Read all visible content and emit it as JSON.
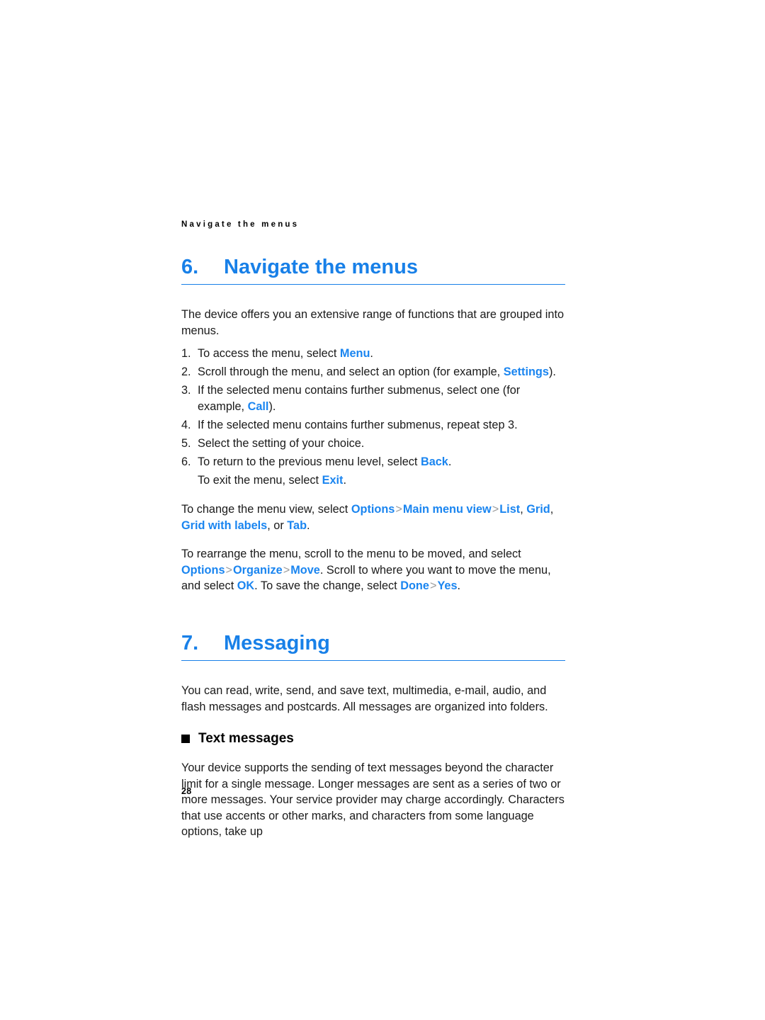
{
  "page": {
    "running_head": "Navigate the menus",
    "folio": "28",
    "accent_color": "#1880E8",
    "inline_accent_color": "#1A85F0",
    "separator_color": "#9b9b9b",
    "background_color": "#ffffff",
    "text_color": "#1a1a1a"
  },
  "chapter_navigate": {
    "number": "6.",
    "title": "Navigate the menus",
    "intro": "The device offers you an extensive range of functions that are grouped into menus.",
    "steps": [
      {
        "marker": "1.",
        "parts": [
          {
            "text": "To access the menu, select ",
            "style": "plain"
          },
          {
            "text": "Menu",
            "style": "ui"
          },
          {
            "text": ".",
            "style": "plain"
          }
        ]
      },
      {
        "marker": "2.",
        "parts": [
          {
            "text": "Scroll through the menu, and select an option (for example, ",
            "style": "plain"
          },
          {
            "text": "Settings",
            "style": "ui"
          },
          {
            "text": ").",
            "style": "plain"
          }
        ]
      },
      {
        "marker": "3.",
        "parts": [
          {
            "text": "If the selected menu contains further submenus, select one (for example, ",
            "style": "plain"
          },
          {
            "text": "Call",
            "style": "ui"
          },
          {
            "text": ").",
            "style": "plain"
          }
        ]
      },
      {
        "marker": "4.",
        "parts": [
          {
            "text": "If the selected menu contains further submenus, repeat step 3.",
            "style": "plain"
          }
        ]
      },
      {
        "marker": "5.",
        "parts": [
          {
            "text": "Select the setting of your choice.",
            "style": "plain"
          }
        ]
      },
      {
        "marker": "6.",
        "parts": [
          {
            "text": "To return to the previous menu level, select ",
            "style": "plain"
          },
          {
            "text": "Back",
            "style": "ui"
          },
          {
            "text": ".",
            "style": "plain"
          }
        ],
        "sub_parts": [
          {
            "text": "To exit the menu, select ",
            "style": "plain"
          },
          {
            "text": "Exit",
            "style": "ui"
          },
          {
            "text": ".",
            "style": "plain"
          }
        ]
      }
    ],
    "paragraph_menu_view": [
      {
        "text": "To change the menu view, select ",
        "style": "plain"
      },
      {
        "text": "Options",
        "style": "ui"
      },
      {
        "text": ">",
        "style": "sep"
      },
      {
        "text": "Main menu view",
        "style": "ui"
      },
      {
        "text": ">",
        "style": "sep"
      },
      {
        "text": "List",
        "style": "ui"
      },
      {
        "text": ", ",
        "style": "plain"
      },
      {
        "text": "Grid",
        "style": "ui"
      },
      {
        "text": ", ",
        "style": "plain"
      },
      {
        "text": "Grid with labels",
        "style": "ui"
      },
      {
        "text": ", or ",
        "style": "plain"
      },
      {
        "text": "Tab",
        "style": "ui"
      },
      {
        "text": ".",
        "style": "plain"
      }
    ],
    "paragraph_rearrange": [
      {
        "text": "To rearrange the menu, scroll to the menu to be moved, and select ",
        "style": "plain"
      },
      {
        "text": "Options",
        "style": "ui"
      },
      {
        "text": ">",
        "style": "sep"
      },
      {
        "text": "Organize",
        "style": "ui"
      },
      {
        "text": ">",
        "style": "sep"
      },
      {
        "text": "Move",
        "style": "ui"
      },
      {
        "text": ". Scroll to where you want to move the menu, and select ",
        "style": "plain"
      },
      {
        "text": "OK",
        "style": "ui"
      },
      {
        "text": ". To save the change, select ",
        "style": "plain"
      },
      {
        "text": "Done",
        "style": "ui"
      },
      {
        "text": ">",
        "style": "sep"
      },
      {
        "text": "Yes",
        "style": "ui"
      },
      {
        "text": ".",
        "style": "plain"
      }
    ]
  },
  "chapter_messaging": {
    "number": "7.",
    "title": "Messaging",
    "intro": "You can read, write, send, and save text, multimedia, e-mail, audio, and flash messages and postcards. All messages are organized into folders.",
    "section": {
      "bullet": "filled-square",
      "heading": "Text messages",
      "body": "Your device supports the sending of text messages beyond the character limit for a single message. Longer messages are sent as a series of two or more messages. Your service provider may charge accordingly. Characters that use accents or other marks, and characters from some language options, take up"
    }
  }
}
